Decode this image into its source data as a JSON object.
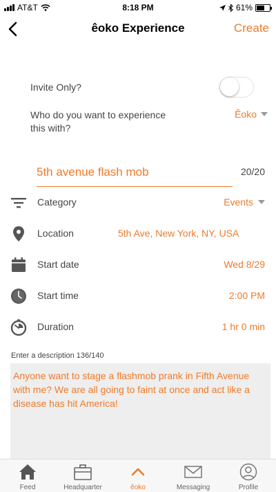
{
  "status_bar": {
    "carrier": "AT&T",
    "time": "8:18 PM",
    "battery": "61%",
    "battery_level": 0.61
  },
  "nav": {
    "title": "êoko Experience",
    "create_label": "Create"
  },
  "form": {
    "invite_label": "Invite Only?",
    "invite_on": false,
    "who_label": "Who do you want to experience this with?",
    "who_value": "Êoko",
    "title_value": "5th avenue flash mob",
    "title_counter": "20/20",
    "fields": [
      {
        "label": "Category",
        "value": "Events",
        "icon": "filter-icon"
      },
      {
        "label": "Location",
        "value": "5th Ave, New York, NY, USA",
        "icon": "location-pin-icon"
      },
      {
        "label": "Start date",
        "value": "Wed 8/29",
        "icon": "calendar-icon"
      },
      {
        "label": "Start time",
        "value": "2:00 PM",
        "icon": "clock-icon"
      },
      {
        "label": "Duration",
        "value": "1 hr 0 min",
        "icon": "timer-icon"
      }
    ],
    "description_label": "Enter a description 136/140",
    "description": "Anyone want to stage a flashmob prank in Fifth Avenue with me? We are all going to faint at once and act like a disease has hit America!"
  },
  "tabs": [
    {
      "label": "Feed",
      "icon": "home-icon"
    },
    {
      "label": "Headquarter",
      "icon": "briefcase-icon"
    },
    {
      "label": "êoko",
      "icon": "chevron-up-icon",
      "active": true
    },
    {
      "label": "Messaging",
      "icon": "envelope-icon"
    },
    {
      "label": "Profile",
      "icon": "user-circle-icon"
    }
  ],
  "colors": {
    "accent": "#ee7a2a",
    "tab_bar": "#f7f7f7",
    "description_bg": "#eeeeee"
  }
}
